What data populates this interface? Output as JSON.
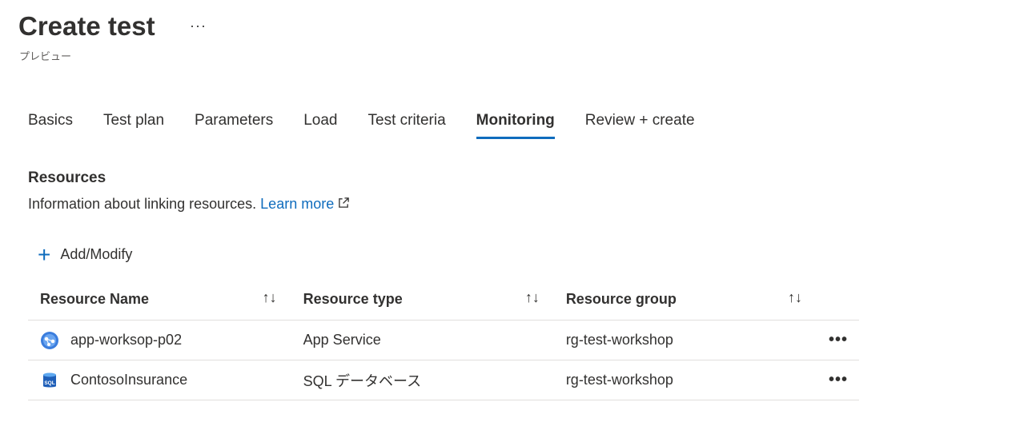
{
  "header": {
    "title": "Create test",
    "more": "···",
    "subtitle": "プレビュー"
  },
  "tabs": [
    {
      "label": "Basics"
    },
    {
      "label": "Test plan"
    },
    {
      "label": "Parameters"
    },
    {
      "label": "Load"
    },
    {
      "label": "Test criteria"
    },
    {
      "label": "Monitoring",
      "active": true
    },
    {
      "label": "Review + create"
    }
  ],
  "resources": {
    "heading": "Resources",
    "info": "Information about linking resources.",
    "learn_more": "Learn more",
    "add_label": "Add/Modify"
  },
  "table": {
    "columns": [
      "Resource Name",
      "Resource type",
      "Resource group"
    ],
    "sort_icon": "↑↓",
    "rows": [
      {
        "name": "app-worksop-p02",
        "type": "App Service",
        "group": "rg-test-workshop",
        "icon": "app-service-icon"
      },
      {
        "name": "ContosoInsurance",
        "type": "SQL データベース",
        "group": "rg-test-workshop",
        "icon": "sql-database-icon",
        "icon_text": "SQL"
      }
    ],
    "row_more": "•••"
  },
  "colors": {
    "accent": "#0f6cbd"
  }
}
